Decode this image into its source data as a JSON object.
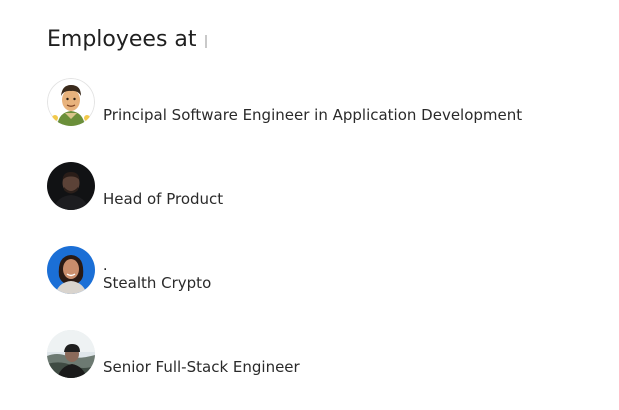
{
  "section": {
    "heading": "Employees at"
  },
  "employees": [
    {
      "name": "",
      "title": "Principal Software Engineer in Application Development",
      "avatar": "cartoon-avatar-icon"
    },
    {
      "name": "",
      "title": "Head of Product",
      "avatar": "person-photo"
    },
    {
      "name": ".",
      "title": "Stealth Crypto",
      "avatar": "person-photo"
    },
    {
      "name": "",
      "title": "Senior Full-Stack Engineer",
      "avatar": "person-photo"
    }
  ]
}
